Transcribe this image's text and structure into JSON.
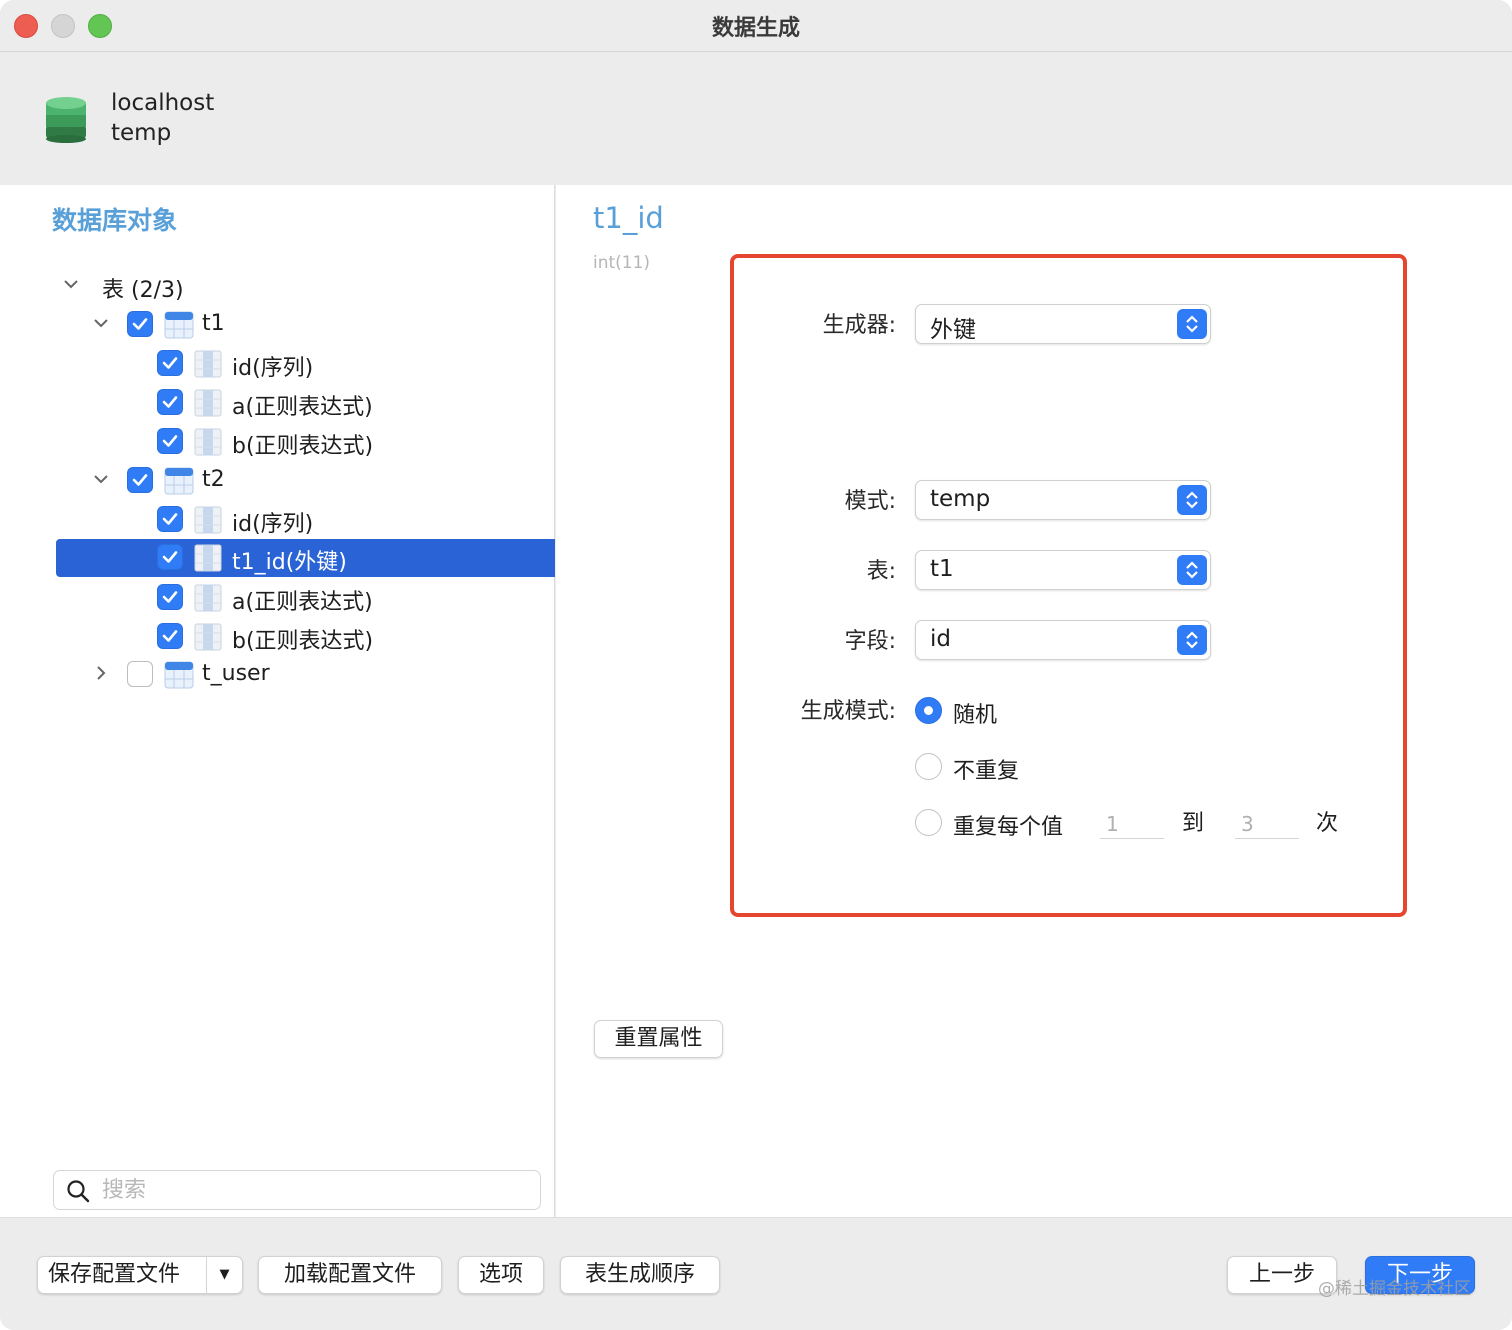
{
  "window": {
    "title": "数据生成"
  },
  "connection": {
    "host": "localhost",
    "database": "temp"
  },
  "left_panel": {
    "title": "数据库对象",
    "tables_group": "表 (2/3)",
    "tree": [
      {
        "label": "t1",
        "checked": true,
        "kind": "table"
      },
      {
        "label": "id(序列)",
        "checked": true,
        "kind": "column"
      },
      {
        "label": "a(正则表达式)",
        "checked": true,
        "kind": "column"
      },
      {
        "label": "b(正则表达式)",
        "checked": true,
        "kind": "column"
      },
      {
        "label": "t2",
        "checked": true,
        "kind": "table"
      },
      {
        "label": "id(序列)",
        "checked": true,
        "kind": "column"
      },
      {
        "label": "t1_id(外键)",
        "checked": true,
        "kind": "column",
        "selected": true
      },
      {
        "label": "a(正则表达式)",
        "checked": true,
        "kind": "column"
      },
      {
        "label": "b(正则表达式)",
        "checked": true,
        "kind": "column"
      },
      {
        "label": "t_user",
        "checked": false,
        "kind": "table"
      }
    ],
    "search_placeholder": "搜索"
  },
  "right_panel": {
    "field_name": "t1_id",
    "field_type": "int(11)",
    "generator_label": "生成器:",
    "generator_value": "外键",
    "schema_label": "模式:",
    "schema_value": "temp",
    "table_label": "表:",
    "table_value": "t1",
    "field_label": "字段:",
    "field_value": "id",
    "mode_label": "生成模式:",
    "mode_options": [
      "随机",
      "不重复",
      "重复每个值"
    ],
    "mode_selected": "随机",
    "repeat_from": "1",
    "repeat_to_label": "到",
    "repeat_to": "3",
    "repeat_times_label": "次",
    "reset_button": "重置属性"
  },
  "bottom_bar": {
    "save_profile": "保存配置文件",
    "load_profile": "加载配置文件",
    "options": "选项",
    "table_order": "表生成顺序",
    "prev": "上一步",
    "next": "下一步"
  },
  "watermark": "@稀土掘金技术社区",
  "colors": {
    "accent": "#2f7cf6",
    "selection": "#2a63d6",
    "highlight_border": "#e6452f",
    "section_title": "#5aa0d8"
  }
}
